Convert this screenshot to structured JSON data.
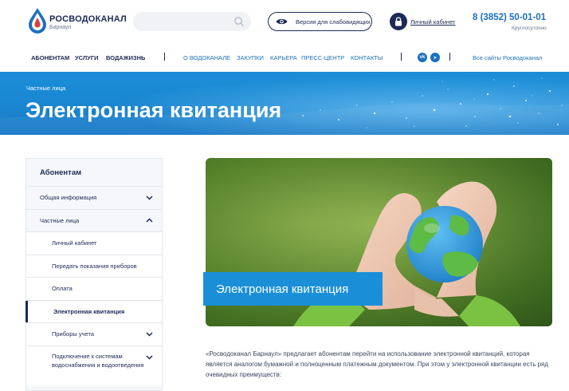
{
  "brand": {
    "name": "РОСВОДОКАНАЛ",
    "city": "Барнаул",
    "colors": {
      "navy": "#1c2a55",
      "blue": "#1c6fbf",
      "accent": "#1a8fd8",
      "drop_red": "#e03a3e"
    }
  },
  "header": {
    "search": {
      "placeholder": "",
      "icon": "search-icon"
    },
    "vision_button": {
      "label": "Версия для слабовидящих",
      "icon": "eye-icon"
    },
    "cabinet": {
      "label": "Личный кабинет",
      "icon": "lock-icon"
    },
    "phone": "8 (3852) 50-01-01",
    "phone_note": "Круглосуточно"
  },
  "nav": {
    "main": [
      "АБОНЕНТАМ",
      "УСЛУГИ",
      "ВОДАЖИЗНЬ"
    ],
    "secondary": [
      "О ВОДОКАНАЛЕ",
      "ЗАКУПКИ",
      "КАРЬЕРА",
      "ПРЕСС-ЦЕНТР",
      "КОНТАКТЫ"
    ],
    "social": [
      {
        "icon": "vk-icon",
        "glyph": "vk"
      },
      {
        "icon": "telegram-icon",
        "glyph": "➤"
      }
    ],
    "all_sites": "Все сайты Росводоканал"
  },
  "banner": {
    "breadcrumb": "Частные лица",
    "title": "Электронная квитанция"
  },
  "sidebar": {
    "title": "Абонентам",
    "items": [
      {
        "label": "Общая информация",
        "level": 1,
        "chevron": "down"
      },
      {
        "label": "Частные лица",
        "level": 1,
        "chevron": "up"
      },
      {
        "label": "Личный кабинет",
        "level": 2
      },
      {
        "label": "Передать показания приборов",
        "level": 2
      },
      {
        "label": "Оплата",
        "level": 2
      },
      {
        "label": "Электронная квитанция",
        "level": 2,
        "active": true
      },
      {
        "label": "Приборы учета",
        "level": 2,
        "chevron": "down"
      },
      {
        "label": "Подключение к системам водоснабжения и водоотведения",
        "level": 2,
        "chevron": "down"
      }
    ]
  },
  "hero": {
    "label": "Электронная квитанция"
  },
  "content": {
    "paragraph": "«Росводоканал Барнаул» предлагает абонентам перейти на использование электронной квитанций, которая является аналогом бумажной и полноценным платежным документом. При этом у электронной квитанции есть ряд очевидных преимуществ:"
  }
}
